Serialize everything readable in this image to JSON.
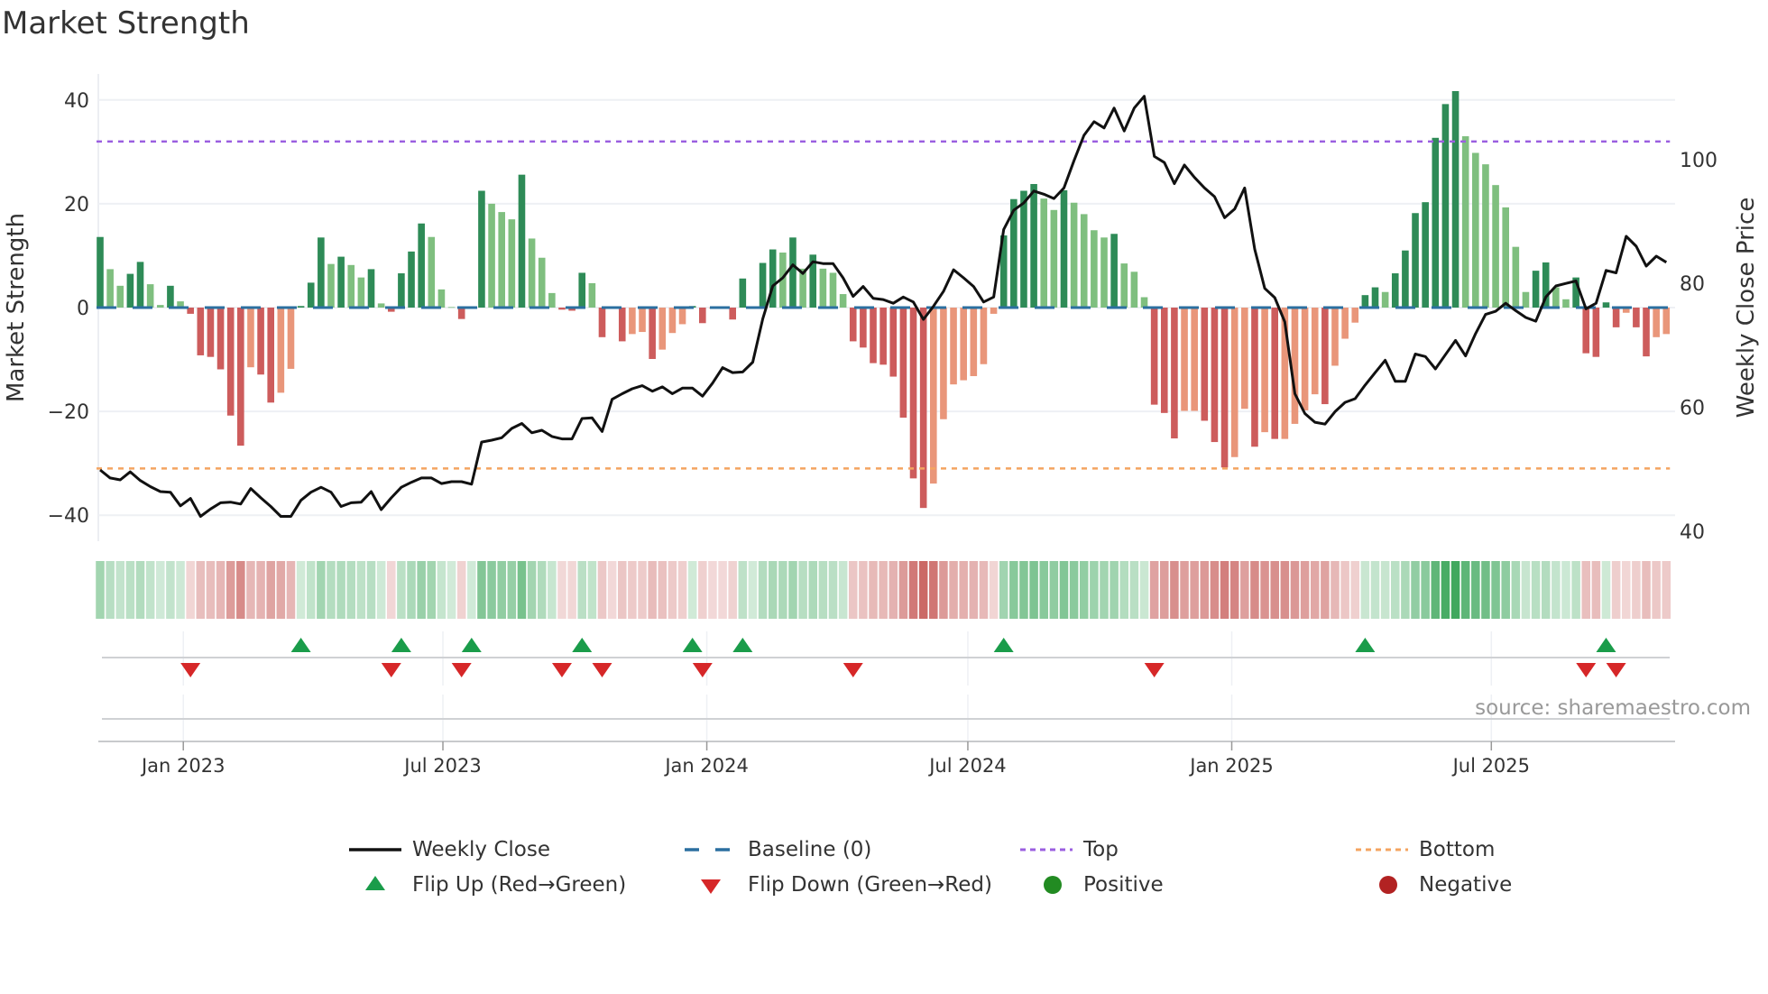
{
  "title": "Market Strength",
  "source": "source: sharemaestro.com",
  "legend": {
    "weekly_close": "Weekly Close",
    "baseline": "Baseline (0)",
    "top": "Top",
    "bottom": "Bottom",
    "flip_up": "Flip Up (Red→Green)",
    "flip_down": "Flip Down (Green→Red)",
    "positive": "Positive",
    "negative": "Negative"
  },
  "colors": {
    "strong_green": "#2e8b57",
    "weak_green": "#7fbf7f",
    "strong_red": "#cd5c5c",
    "weak_red": "#e9967a",
    "baseline": "#2b6fa0",
    "top": "#9b5fe0",
    "bottom": "#f4a460",
    "flip_up": "#1a9c4a",
    "flip_down": "#d62728",
    "positive": "#228b22",
    "negative": "#b22222",
    "close": "#111111"
  },
  "chart_data": {
    "type": "bar",
    "title": "Market Strength",
    "ylabel": "Market Strength",
    "y2label": "Weekly Close Price",
    "ylim": [
      -45,
      45
    ],
    "y2lim": [
      38.4,
      113.8
    ],
    "yticks": [
      -40,
      -20,
      0,
      20,
      40
    ],
    "y2ticks": [
      40,
      60,
      80,
      100
    ],
    "xticks": [
      {
        "date": "2023-01-01",
        "label": "Jan 2023"
      },
      {
        "date": "2023-07-01",
        "label": "Jul 2023"
      },
      {
        "date": "2024-01-01",
        "label": "Jan 2024"
      },
      {
        "date": "2024-07-01",
        "label": "Jul 2024"
      },
      {
        "date": "2025-01-01",
        "label": "Jan 2025"
      },
      {
        "date": "2025-07-01",
        "label": "Jul 2025"
      }
    ],
    "start_date": "2022-11-04",
    "interval": "weekly",
    "top_level": 32,
    "bottom_level": -31,
    "baseline": 0,
    "strength": [
      13.6,
      7.4,
      4.2,
      6.5,
      8.8,
      4.5,
      0.5,
      4.2,
      1.2,
      -1.2,
      -9.2,
      -9.5,
      -11.9,
      -20.8,
      -26.6,
      -11.5,
      -12.9,
      -18.3,
      -16.4,
      -11.8,
      0.3,
      4.8,
      13.5,
      8.4,
      9.8,
      8.2,
      5.8,
      7.4,
      0.8,
      -0.8,
      6.6,
      10.8,
      16.2,
      13.6,
      3.5,
      0.1,
      -2.2,
      0.2,
      22.5,
      20.0,
      18.4,
      17.0,
      25.6,
      13.3,
      9.6,
      2.8,
      -0.4,
      -0.6,
      6.7,
      4.7,
      -5.7,
      -0.1,
      -6.5,
      -5.1,
      -4.7,
      -9.9,
      -8.1,
      -4.9,
      -3.2,
      0.3,
      -3.0,
      -0.1,
      -0.1,
      -2.3,
      5.6,
      0.1,
      8.6,
      11.2,
      10.6,
      13.5,
      7.5,
      10.2,
      7.5,
      6.7,
      2.6,
      -6.5,
      -7.7,
      -10.7,
      -11.0,
      -13.3,
      -21.2,
      -32.9,
      -38.6,
      -33.9,
      -21.5,
      -14.8,
      -14.0,
      -13.2,
      -10.9,
      -1.2,
      13.9,
      20.9,
      22.5,
      23.8,
      21.0,
      18.8,
      22.6,
      20.2,
      18.0,
      14.9,
      13.5,
      14.2,
      8.5,
      6.9,
      2.0,
      -18.7,
      -20.3,
      -25.2,
      -19.9,
      -19.9,
      -21.8,
      -25.9,
      -30.8,
      -28.8,
      -19.5,
      -26.8,
      -24.0,
      -25.3,
      -25.3,
      -22.4,
      -19.8,
      -16.7,
      -18.6,
      -11.2,
      -6.0,
      -2.9,
      2.4,
      3.9,
      3.0,
      6.6,
      11.0,
      18.2,
      20.3,
      32.7,
      39.2,
      41.7,
      33.0,
      29.8,
      27.6,
      23.6,
      19.3,
      11.7,
      3.0,
      7.1,
      8.7,
      3.9,
      1.6,
      5.8,
      -8.8,
      -9.5,
      1.0,
      -3.8,
      -1.0,
      -3.8,
      -9.4,
      -5.7,
      -5.1
    ],
    "weekly_close": [
      49.9,
      48.6,
      48.3,
      49.6,
      48.2,
      47.2,
      46.4,
      46.3,
      44.1,
      45.3,
      42.4,
      43.6,
      44.6,
      44.7,
      44.4,
      46.9,
      45.4,
      44.0,
      42.4,
      42.4,
      45.0,
      46.3,
      47.1,
      46.3,
      44.0,
      44.6,
      44.7,
      46.4,
      43.5,
      45.4,
      47.1,
      47.9,
      48.6,
      48.6,
      47.7,
      48.0,
      48.0,
      47.6,
      54.4,
      54.7,
      55.1,
      56.6,
      57.4,
      55.9,
      56.3,
      55.3,
      54.9,
      54.9,
      58.2,
      58.3,
      56.1,
      61.3,
      62.2,
      63.0,
      63.5,
      62.6,
      63.3,
      62.2,
      63.1,
      63.1,
      61.8,
      63.9,
      66.4,
      65.6,
      65.7,
      67.3,
      74.3,
      79.6,
      80.9,
      83.0,
      81.6,
      83.5,
      83.2,
      83.2,
      80.9,
      77.9,
      79.5,
      77.6,
      77.4,
      76.8,
      77.8,
      77.0,
      74.2,
      76.3,
      78.7,
      82.2,
      80.9,
      79.5,
      77.0,
      77.8,
      88.7,
      91.8,
      93.0,
      94.9,
      94.4,
      93.7,
      95.4,
      99.8,
      103.9,
      106.1,
      105.1,
      108.3,
      104.6,
      108.3,
      110.2,
      100.5,
      99.5,
      96.1,
      99.1,
      97.1,
      95.4,
      94.0,
      90.6,
      92.0,
      95.4,
      85.5,
      79.2,
      77.7,
      73.8,
      62.2,
      59.0,
      57.6,
      57.3,
      59.3,
      60.8,
      61.4,
      63.6,
      65.6,
      67.6,
      64.2,
      64.2,
      68.6,
      68.2,
      66.2,
      68.5,
      70.8,
      68.3,
      71.9,
      75.0,
      75.5,
      76.8,
      75.6,
      74.5,
      73.9,
      77.8,
      79.6,
      80.0,
      80.4,
      75.9,
      76.8,
      82.1,
      81.7,
      87.6,
      86.0,
      82.8,
      84.4,
      83.4
    ],
    "legend_placement": "bottom-center"
  }
}
